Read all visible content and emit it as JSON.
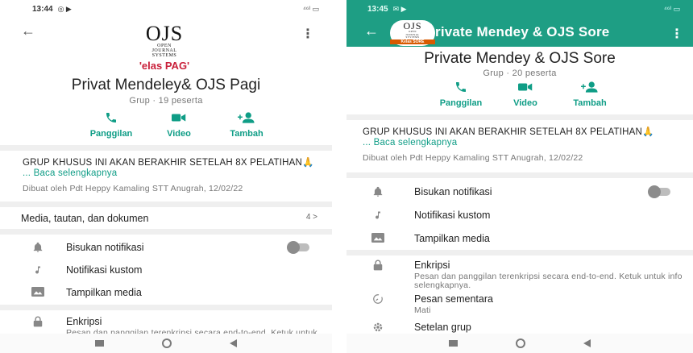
{
  "left": {
    "status": {
      "time": "13:44",
      "glyphs": "◎ ▶",
      "right": "⁴⁶ᴵ ▭"
    },
    "logo": {
      "big": "OJS",
      "line1": "OPEN",
      "line2": "JOURNAL",
      "line3": "SYSTEMS",
      "banner": "'elas PAG'"
    },
    "group_name": "Privat Mendeley& OJS Pagi",
    "group_meta": "Grup · 19 peserta",
    "actions": [
      {
        "label": "Panggilan",
        "icon": "phone-icon"
      },
      {
        "label": "Video",
        "icon": "video-icon"
      },
      {
        "label": "Tambah",
        "icon": "add-person-icon"
      }
    ],
    "description": {
      "text": "GRUP KHUSUS INI AKAN BERAKHIR SETELAH 8X PELATIHAN🙏",
      "read_more": "... Baca selengkapnya",
      "created_by": "Dibuat oleh Pdt Heppy Kamaling STT Anugrah, 12/02/22"
    },
    "media": {
      "label": "Media, tautan, dan dokumen",
      "count": "4 >"
    },
    "rows": [
      {
        "label": "Bisukan notifikasi",
        "icon": "bell-icon"
      },
      {
        "label": "Notifikasi kustom",
        "icon": "music-note-icon"
      },
      {
        "label": "Tampilkan media",
        "icon": "image-icon"
      },
      {
        "label": "Enkripsi",
        "sub": "Pesan dan panggilan terenkripsi secara end-to-end. Ketuk untuk info selengkapnya.",
        "icon": "lock-icon"
      }
    ]
  },
  "right": {
    "status": {
      "time": "13:45",
      "glyphs": "✉ ▶",
      "right": "⁴⁶ᴵ ▭"
    },
    "logo": {
      "big": "OJS",
      "line1": "OPEN",
      "line2": "JOURNAL",
      "line3": "SYSTEMS",
      "banner": "Kelas SORE"
    },
    "appbar_title": "rivate Mendey & OJS Sore",
    "group_name": "Private Mendey & OJS Sore",
    "group_meta": "Grup · 20 peserta",
    "actions": [
      {
        "label": "Panggilan",
        "icon": "phone-icon"
      },
      {
        "label": "Video",
        "icon": "video-icon"
      },
      {
        "label": "Tambah",
        "icon": "add-person-icon"
      }
    ],
    "description": {
      "text": "GRUP KHUSUS INI AKAN BERAKHIR SETELAH 8X PELATIHAN🙏",
      "read_more": "... Baca selengkapnya",
      "created_by": "Dibuat oleh Pdt Heppy Kamaling STT Anugrah, 12/02/22"
    },
    "rows": [
      {
        "label": "Bisukan notifikasi",
        "icon": "bell-icon"
      },
      {
        "label": "Notifikasi kustom",
        "icon": "music-note-icon"
      },
      {
        "label": "Tampilkan media",
        "icon": "image-icon"
      },
      {
        "label": "Enkripsi",
        "sub": "Pesan dan panggilan terenkripsi secara end-to-end. Ketuk untuk info selengkapnya.",
        "icon": "lock-icon"
      },
      {
        "label": "Pesan sementara",
        "sub": "Mati",
        "icon": "timer-icon"
      },
      {
        "label": "Setelan grup",
        "icon": "gear-icon"
      }
    ]
  },
  "colors": {
    "accent": "#0f9d86",
    "appbar": "#1e9e84",
    "banner": "#c9203a"
  }
}
